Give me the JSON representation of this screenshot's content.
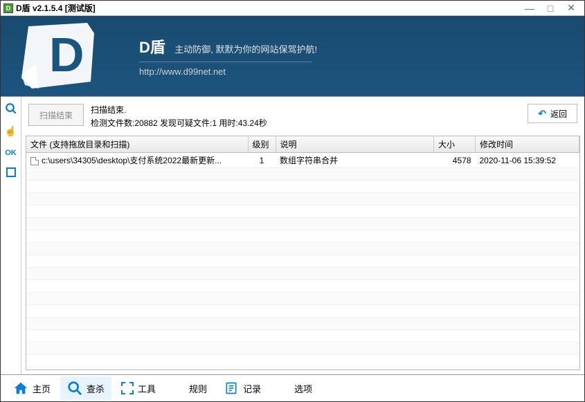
{
  "titlebar": {
    "icon_letter": "D",
    "title": "D盾 v2.1.5.4 [测试版]"
  },
  "header": {
    "title": "D盾",
    "slogan": "主动防御, 默默为你的网站保驾护航!",
    "url": "http://www.d99net.net"
  },
  "sidebar": {
    "items": [
      "search",
      "hand",
      "OK",
      "square"
    ]
  },
  "toolbar": {
    "scan_button": "扫描结束",
    "status_line1": "扫描结束.",
    "status_line2": "检测文件数:20882 发现可疑文件:1 用时:43.24秒",
    "return_button": "返回"
  },
  "table": {
    "columns": {
      "file": "文件 (支持拖放目录和扫描)",
      "level": "级别",
      "desc": "说明",
      "size": "大小",
      "mtime": "修改时间"
    },
    "rows": [
      {
        "file": "c:\\users\\34305\\desktop\\支付系统2022最新更新...",
        "level": "1",
        "desc": "数组字符串合并",
        "size": "4578",
        "mtime": "2020-11-06 15:39:52"
      }
    ]
  },
  "bottom_nav": {
    "home": "主页",
    "scan": "查杀",
    "tools": "工具",
    "rules": "规则",
    "log": "记录",
    "options": "选项"
  }
}
